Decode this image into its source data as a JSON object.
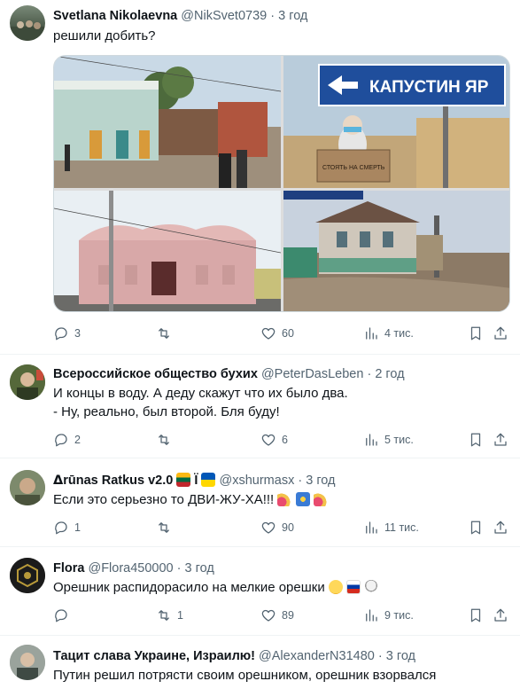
{
  "tweets": [
    {
      "name": "Svetlana Nikolaevna",
      "handle": "@NikSvet0739",
      "time": "3 год",
      "text": "решили добить?",
      "stats": {
        "replies": "3",
        "retweets": "",
        "likes": "60",
        "views": "4 тис."
      },
      "media": {
        "sign_text": "КАПУСТИН ЯР",
        "placard_text": "СТОЯТЬ НА СМЕРТЬ"
      }
    },
    {
      "name": "Всероссийское общество бухих",
      "handle": "@PeterDasLeben",
      "time": "2 год",
      "text_lines": [
        "И концы в воду. А деду скажут что их было два.",
        "- Ну, реально, был второй. Бля буду!"
      ],
      "stats": {
        "replies": "2",
        "retweets": "",
        "likes": "6",
        "views": "5 тис."
      }
    },
    {
      "name": "ᐃrūnas Ratkus v2.0",
      "name_suffix": "Ï",
      "handle": "@xshurmasx",
      "time": "3 год",
      "text": "Если это серьезно то ДВИ-ЖУ-ХА!!!",
      "stats": {
        "replies": "1",
        "retweets": "",
        "likes": "90",
        "views": "11 тис."
      }
    },
    {
      "name": "Flora",
      "handle": "@Flora450000",
      "time": "3 год",
      "text": "Орешник распидорасило на мелкие орешки",
      "stats": {
        "replies": "",
        "retweets": "1",
        "likes": "89",
        "views": "9 тис."
      }
    },
    {
      "name": "Тацит слава Украине, Израилю!",
      "handle": "@AlexanderN31480",
      "time": "3 год",
      "text": "Путин решил потрясти своим орешником, орешник взорвался"
    }
  ],
  "separator": "·",
  "icons": [
    "reply-icon",
    "retweet-icon",
    "like-icon",
    "views-icon",
    "bookmark-icon",
    "share-icon"
  ],
  "colors": {
    "text": "#0f1419",
    "muted": "#536471",
    "divider": "#eff3f4",
    "sign_blue": "#1f4e9c"
  }
}
